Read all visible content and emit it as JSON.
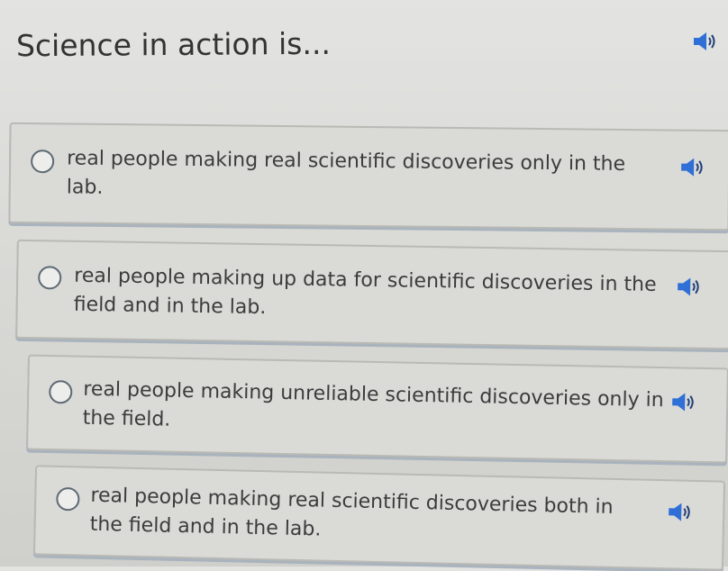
{
  "question": {
    "text": "Science in action is...",
    "audio_icon": "speaker-icon"
  },
  "options": [
    {
      "label": "real people making real scientific discoveries only in the lab.",
      "selected": false,
      "audio_icon": "speaker-icon"
    },
    {
      "label": "real people making up data for scientific discoveries in the field and in the lab.",
      "selected": false,
      "audio_icon": "speaker-icon"
    },
    {
      "label": "real people making unreliable scientific discoveries only in the field.",
      "selected": false,
      "audio_icon": "speaker-icon"
    },
    {
      "label": "real people making real scientific discoveries both in the field and in the lab.",
      "selected": false,
      "audio_icon": "speaker-icon"
    }
  ],
  "colors": {
    "background": "#d9d9d6",
    "text": "#3c3c3c",
    "radio_border": "#5e6a74",
    "speaker_blue": "#2f6fd6"
  }
}
